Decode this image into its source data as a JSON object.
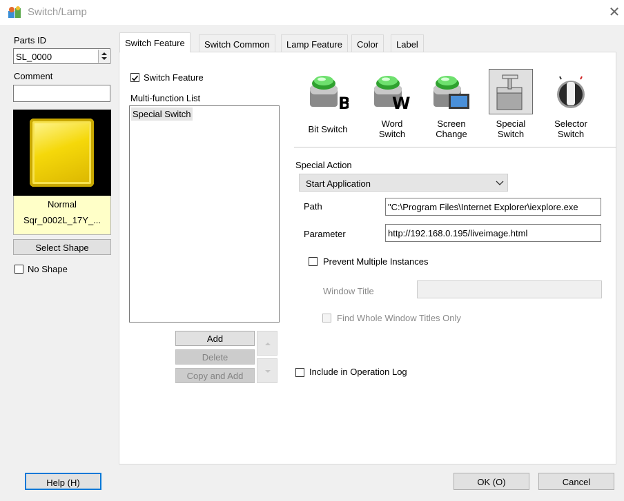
{
  "window": {
    "title": "Switch/Lamp",
    "icon": "switch-lamp-app-icon",
    "close_icon": "close-icon"
  },
  "left": {
    "parts_id_label": "Parts ID",
    "parts_id_value": "SL_0000",
    "comment_label": "Comment",
    "comment_value": "",
    "preview": {
      "state": "Normal",
      "shape_name": "Sqr_0002L_17Y_...",
      "lamp_color": "#f5d80a"
    },
    "select_shape_label": "Select Shape",
    "no_shape_label": "No Shape",
    "no_shape_checked": false
  },
  "tabs": [
    {
      "label": "Switch Feature",
      "active": true
    },
    {
      "label": "Switch Common",
      "active": false
    },
    {
      "label": "Lamp Feature",
      "active": false
    },
    {
      "label": "Color",
      "active": false
    },
    {
      "label": "Label",
      "active": false
    }
  ],
  "switch_feature": {
    "enable_label": "Switch Feature",
    "enable_checked": true,
    "list_label": "Multi-function List",
    "list_items": [
      "Special Switch"
    ],
    "add_label": "Add",
    "delete_label": "Delete",
    "copy_add_label": "Copy and Add"
  },
  "switch_types": [
    {
      "label": "Bit Switch",
      "icon": "bit-switch-icon",
      "selected": false
    },
    {
      "label": "Word\nSwitch",
      "icon": "word-switch-icon",
      "selected": false
    },
    {
      "label": "Screen\nChange",
      "icon": "screen-change-icon",
      "selected": false
    },
    {
      "label": "Special\nSwitch",
      "icon": "special-switch-icon",
      "selected": true
    },
    {
      "label": "Selector\nSwitch",
      "icon": "selector-switch-icon",
      "selected": false
    }
  ],
  "special_action": {
    "label": "Special Action",
    "selected": "Start Application",
    "path_label": "Path",
    "path_value": "\"C:\\Program Files\\Internet Explorer\\iexplore.exe",
    "parameter_label": "Parameter",
    "parameter_value": "http://192.168.0.195/liveimage.html",
    "prevent_multiple_label": "Prevent Multiple Instances",
    "prevent_multiple_checked": false,
    "window_title_label": "Window Title",
    "window_title_value": "",
    "find_whole_label": "Find Whole Window Titles Only",
    "find_whole_checked": false
  },
  "operation_log_label": "Include in Operation Log",
  "operation_log_checked": false,
  "footer": {
    "help_label": "Help (H)",
    "ok_label": "OK (O)",
    "cancel_label": "Cancel"
  }
}
